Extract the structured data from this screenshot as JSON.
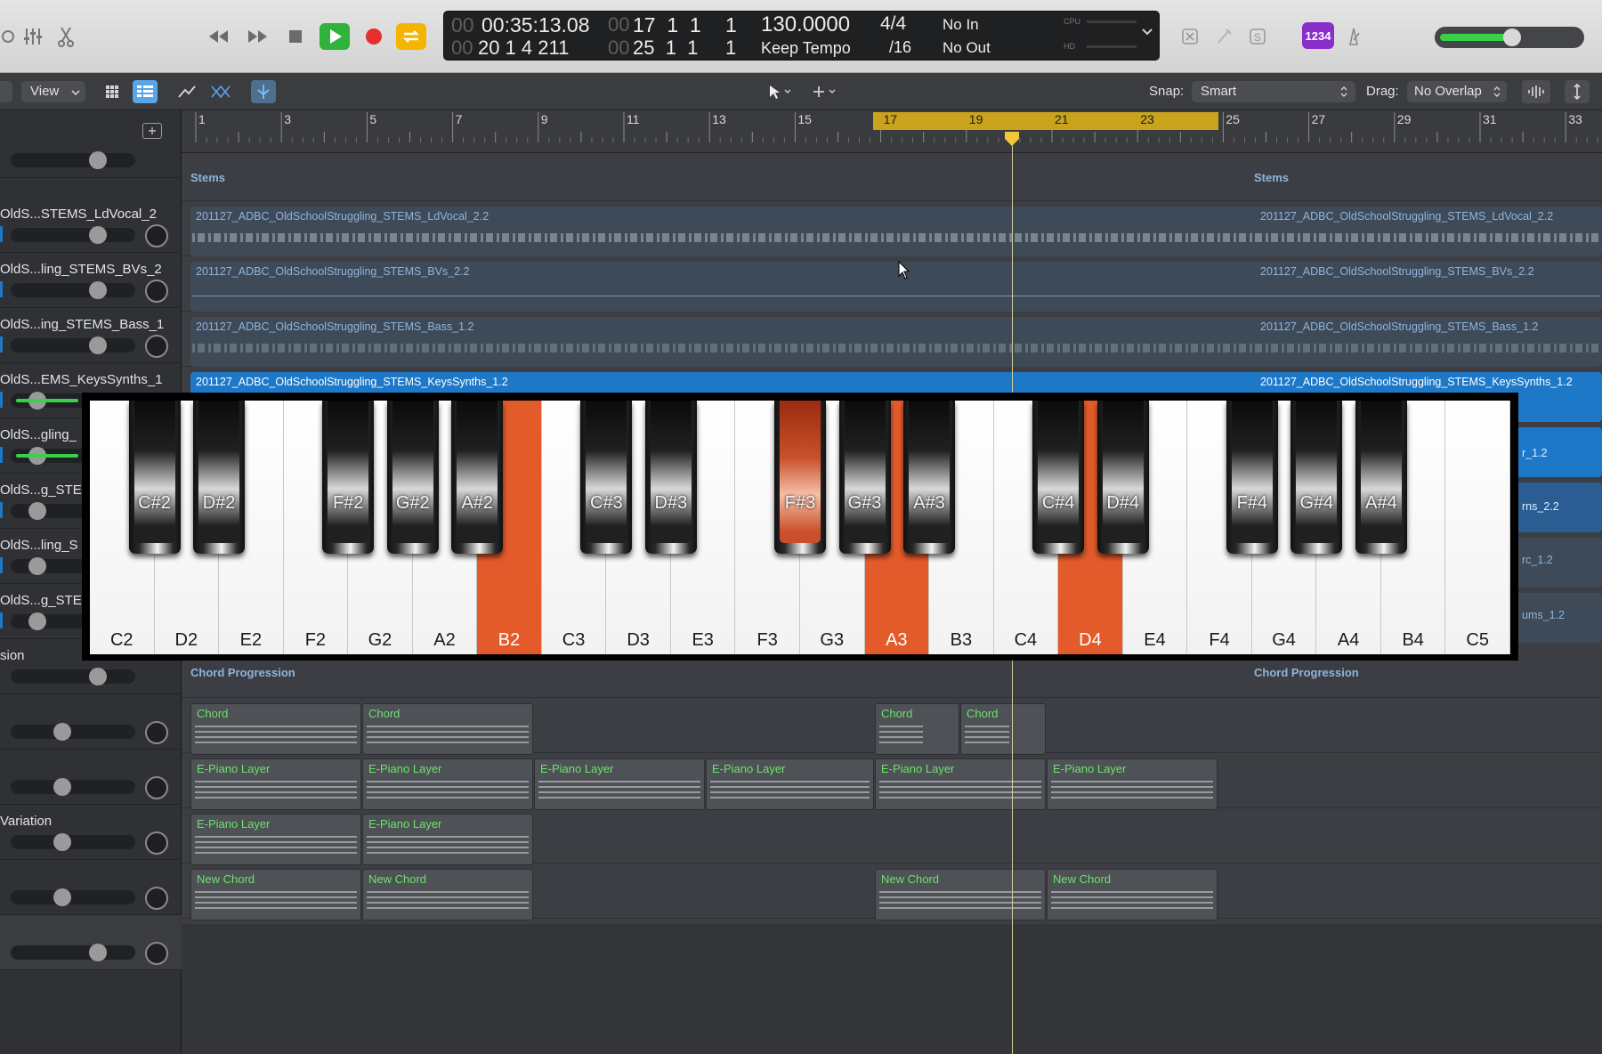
{
  "lcd": {
    "time": "00:35:13.08",
    "time_prefix": "00",
    "position": "17  1  1",
    "position_ticks": "1",
    "position_dim": "00",
    "end": "20  1  4  211",
    "end_dim": "00",
    "cycle_end": "25  1  1",
    "cycle_ticks": "1",
    "tempo": "130.0000",
    "tempo_mode": "Keep Tempo",
    "signature": "4/4",
    "division": "/16",
    "midi_in": "No In",
    "midi_out": "No Out",
    "cpu_label": "CPU",
    "hd_label": "HD"
  },
  "toolbar": {
    "view_label": "View",
    "snap_label": "Snap:",
    "snap_value": "Smart",
    "drag_label": "Drag:",
    "drag_value": "No Overlap",
    "badge_count_in": "1234"
  },
  "colors": {
    "accent_play": "#2fb33d",
    "accent_record": "#e62e2e",
    "accent_cycle": "#f5b400",
    "piano_highlight": "#e35b2b",
    "midi_text": "#6ce36a",
    "stems_region": "#3e4a58",
    "selected_region": "#1e78c8"
  },
  "ruler": {
    "bars": [
      "1",
      "3",
      "5",
      "7",
      "9",
      "11",
      "13",
      "15",
      "17",
      "19",
      "21",
      "23",
      "25",
      "27",
      "29",
      "31",
      "33"
    ]
  },
  "tracks": [
    {
      "name": "",
      "type": "folder-stems"
    },
    {
      "name": "OldS...STEMS_LdVocal_2"
    },
    {
      "name": "OldS...ling_STEMS_BVs_2"
    },
    {
      "name": "OldS...ing_STEMS_Bass_1"
    },
    {
      "name": "OldS...EMS_KeysSynths_1"
    },
    {
      "name": "OldS...gling_"
    },
    {
      "name": "OldS...g_STE"
    },
    {
      "name": "OldS...ling_S"
    },
    {
      "name": "OldS...g_STE"
    },
    {
      "name": "sion"
    },
    {
      "name": ""
    },
    {
      "name": ""
    },
    {
      "name": "Variation"
    },
    {
      "name": ""
    },
    {
      "name": ""
    }
  ],
  "stems": {
    "folder_label_a": "Stems",
    "folder_label_b": "Stems",
    "ldvocal_a": "201127_ADBC_OldSchoolStruggling_STEMS_LdVocal_2.2",
    "ldvocal_b": "201127_ADBC_OldSchoolStruggling_STEMS_LdVocal_2.2",
    "bvs_a": "201127_ADBC_OldSchoolStruggling_STEMS_BVs_2.2",
    "bvs_b": "201127_ADBC_OldSchoolStruggling_STEMS_BVs_2.2",
    "bass_a": "201127_ADBC_OldSchoolStruggling_STEMS_Bass_1.2",
    "bass_b": "201127_ADBC_OldSchoolStruggling_STEMS_Bass_1.2",
    "keys_a": "201127_ADBC_OldSchoolStruggling_STEMS_KeysSynths_1.2",
    "keys_b": "201127_ADBC_OldSchoolStruggling_STEMS_KeysSynths_1.2",
    "partial_1": "r_1.2",
    "partial_2": "rns_2.2",
    "partial_3": "rc_1.2",
    "partial_4": "ums_1.2"
  },
  "chords": {
    "folder_a": "Chord Progression",
    "folder_b": "Chord Progression",
    "chord": "Chord",
    "epiano": "E-Piano Layer",
    "newchord": "New Chord"
  },
  "piano": {
    "white_keys": [
      "C2",
      "D2",
      "E2",
      "F2",
      "G2",
      "A2",
      "B2",
      "C3",
      "D3",
      "E3",
      "F3",
      "G3",
      "A3",
      "B3",
      "C4",
      "D4",
      "E4",
      "F4",
      "G4",
      "A4",
      "B4",
      "C5"
    ],
    "white_active": [
      "B2",
      "A3",
      "D4"
    ],
    "black_keys": [
      {
        "label": "C#2",
        "after": 0
      },
      {
        "label": "D#2",
        "after": 1
      },
      {
        "label": "F#2",
        "after": 3
      },
      {
        "label": "G#2",
        "after": 4
      },
      {
        "label": "A#2",
        "after": 5
      },
      {
        "label": "C#3",
        "after": 7
      },
      {
        "label": "D#3",
        "after": 8
      },
      {
        "label": "F#3",
        "after": 10
      },
      {
        "label": "G#3",
        "after": 11
      },
      {
        "label": "A#3",
        "after": 12
      },
      {
        "label": "C#4",
        "after": 14
      },
      {
        "label": "D#4",
        "after": 15
      },
      {
        "label": "F#4",
        "after": 17
      },
      {
        "label": "G#4",
        "after": 18
      },
      {
        "label": "A#4",
        "after": 19
      }
    ],
    "black_active": [
      "F#3"
    ]
  }
}
